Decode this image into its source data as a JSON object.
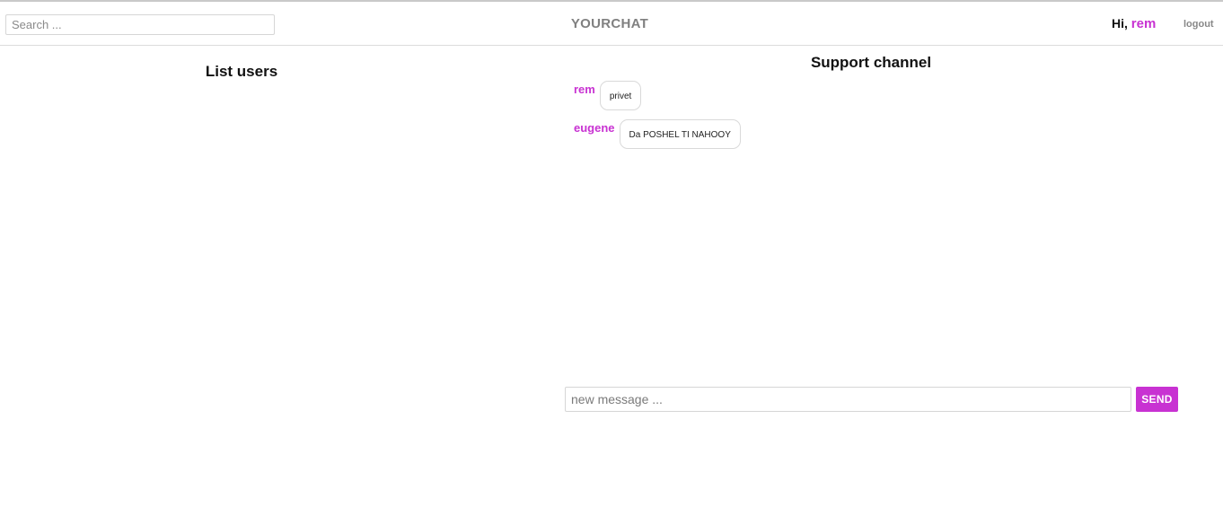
{
  "header": {
    "search_placeholder": "Search ...",
    "search_value": "",
    "brand": "YOURCHAT",
    "greeting_prefix": "Hi,",
    "username": "rem",
    "logout_label": "logout"
  },
  "users_panel": {
    "title": "List users",
    "users": []
  },
  "chat": {
    "title": "Support channel",
    "messages": [
      {
        "author": "rem",
        "text": "privet"
      },
      {
        "author": "eugene",
        "text": "Da POSHEL TI NAHOOY"
      }
    ],
    "input_placeholder": "new message ...",
    "input_value": "",
    "send_label": "SEND"
  },
  "colors": {
    "accent": "#c832d2",
    "brand_text": "#808080",
    "border": "#d9d9d9"
  }
}
